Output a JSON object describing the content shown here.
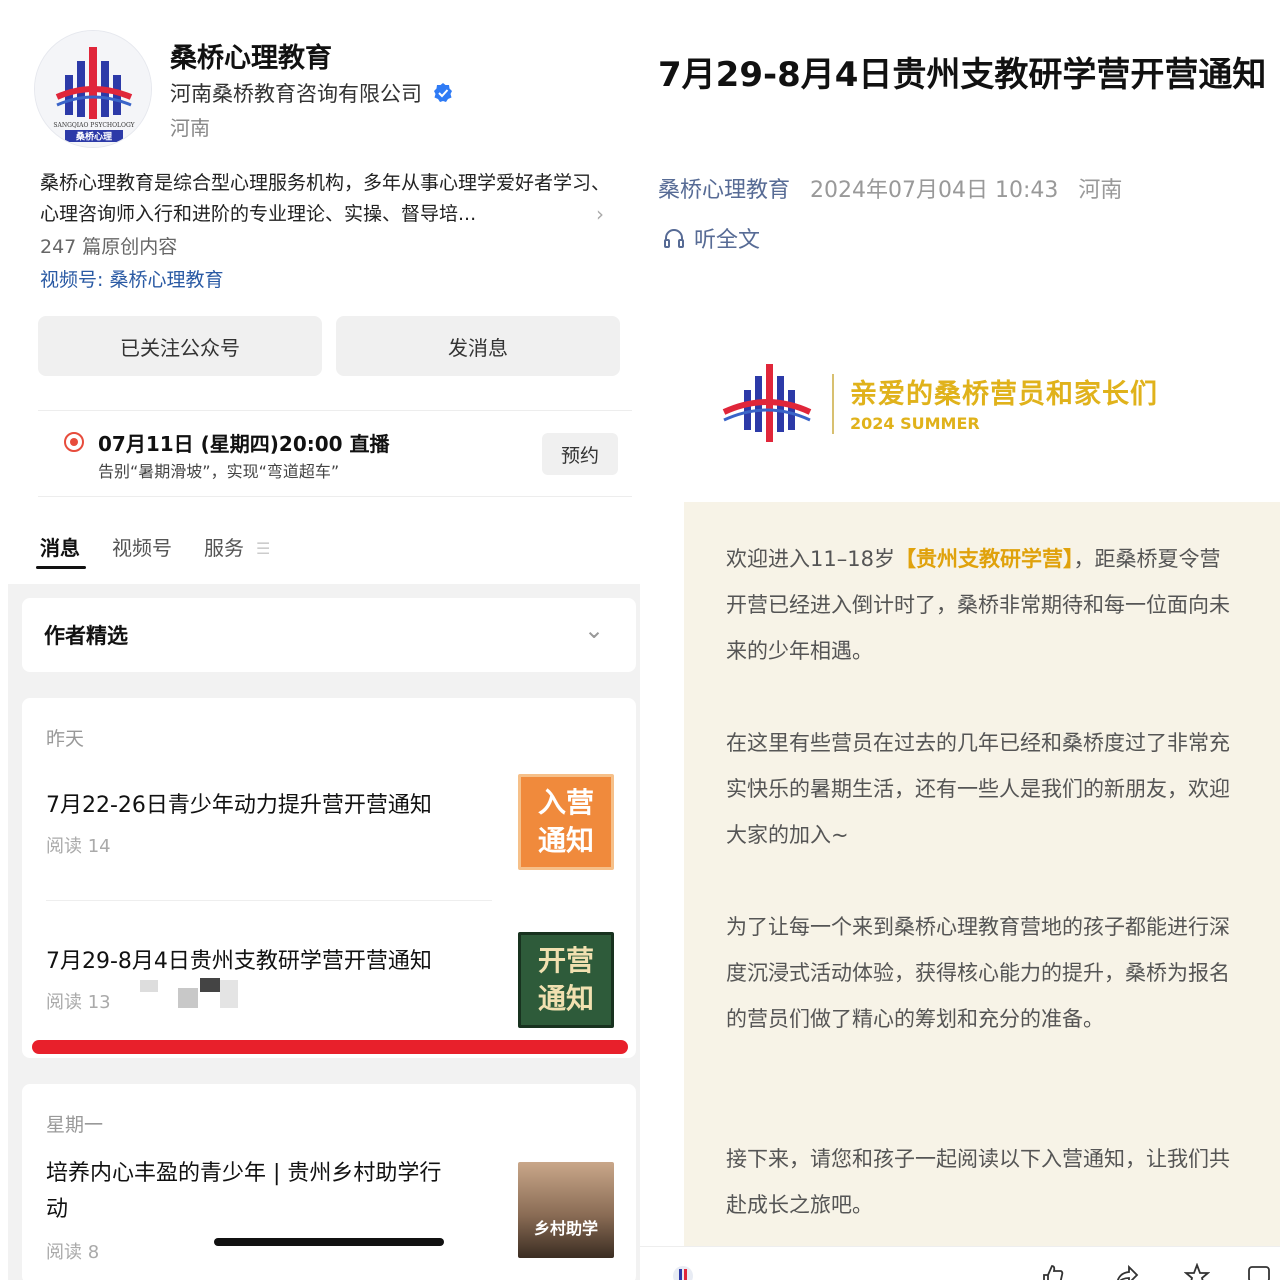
{
  "profile": {
    "name": "桑桥心理教育",
    "company": "河南桑桥教育咨询有限公司",
    "region": "河南",
    "logo_text": "SANGQIAO PSYCHOLOGY",
    "logo_cn": "桑桥心理",
    "description": "桑桥心理教育是综合型心理服务机构，多年从事心理学爱好者学习、心理咨询师入行和进阶的专业理论、实操、督导培...",
    "original_count": "247 篇原创内容",
    "channel": "视频号: 桑桥心理教育",
    "follow_button": "已关注公众号",
    "message_button": "发消息"
  },
  "live": {
    "title": "07月11日 (星期四)20:00 直播",
    "subtitle": "告别“暑期滑坡”，实现“弯道超车”",
    "reserve_button": "预约"
  },
  "tabs": [
    "消息",
    "视频号",
    "服务"
  ],
  "author_picks": "作者精选",
  "feed": {
    "yesterday_label": "昨天",
    "monday_label": "星期一",
    "articles": [
      {
        "title": "7月22-26日青少年动力提升营开营通知",
        "reads": "阅读 14",
        "thumb_line1": "入营",
        "thumb_line2": "通知"
      },
      {
        "title": "7月29-8月4日贵州支教研学营开营通知",
        "reads": "阅读 13",
        "thumb_line1": "开营",
        "thumb_line2": "通知"
      },
      {
        "title_line1": "培养内心丰盈的青少年 | 贵州乡村助学行",
        "title_line2": "动",
        "reads": "阅读 8",
        "thumb_text": "乡村助学"
      }
    ]
  },
  "article": {
    "title": "7月29-8月4日贵州支教研学营开营通知",
    "account": "桑桥心理教育",
    "datetime": "2024年07月04日 10:43",
    "region": "河南",
    "listen": "听全文",
    "banner_title": "亲爱的桑桥营员和家长们",
    "banner_sub": "2024 SUMMER",
    "p1_a": "欢迎进入11–18岁",
    "p1_hl": "【贵州支教研学营】",
    "p1_b": "，距桑桥夏令营开营已经进入倒计时了，桑桥非常期待和每一位面向未来的少年相遇。",
    "p2": "在这里有些营员在过去的几年已经和桑桥度过了非常充实快乐的暑期生活，还有一些人是我们的新朋友，欢迎大家的加入~",
    "p3": "为了让每一个来到桑桥心理教育营地的孩子都能进行深度沉浸式活动体验，获得核心能力的提升，桑桥为报名的营员们做了精心的筹划和充分的准备。",
    "p4": "接下来，请您和孩子一起阅读以下入营通知，让我们共赴成长之旅吧。"
  },
  "colors": {
    "accent_link": "#576b95",
    "highlight": "#e0a20c",
    "red_underline": "#e8202b",
    "verify": "#2f7bf5"
  }
}
